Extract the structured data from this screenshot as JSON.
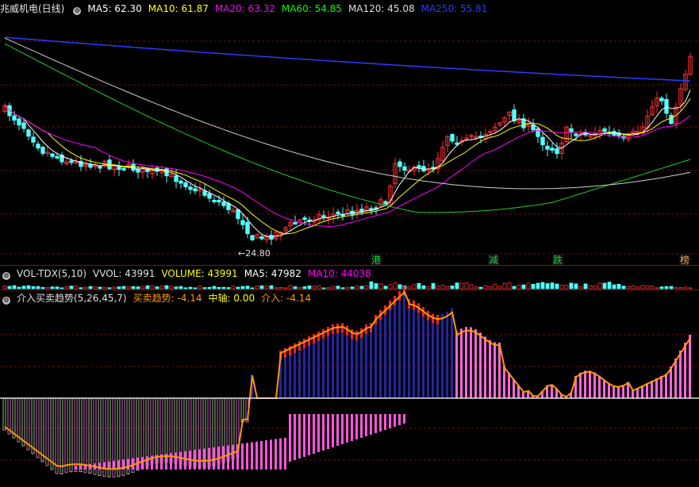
{
  "header": {
    "title": "兆威机电(日线)",
    "ma": [
      {
        "label": "MA5: 62.30",
        "color": "#ffffff"
      },
      {
        "label": "MA10: 61.87",
        "color": "#ffff00"
      },
      {
        "label": "MA20: 63.32",
        "color": "#ff00ff"
      },
      {
        "label": "MA60: 54.85",
        "color": "#00ff00"
      },
      {
        "label": "MA120: 45.08",
        "color": "#dddddd"
      },
      {
        "label": "MA250: 55.81",
        "color": "#2b3cff"
      }
    ]
  },
  "vol_header": {
    "items": [
      {
        "label": "VOL-TDX(5,10)",
        "color": "#e0e0e0"
      },
      {
        "label": "VVOL: 43991",
        "color": "#e0e0e0"
      },
      {
        "label": "VOLUME: 43991",
        "color": "#ffff00"
      },
      {
        "label": "MA5: 47982",
        "color": "#ffffff"
      },
      {
        "label": "MA10: 44038",
        "color": "#ff00ff"
      }
    ]
  },
  "ind_header": {
    "items": [
      {
        "label": "介入买卖趋势(5,26,45,7)",
        "color": "#e0e0e0"
      },
      {
        "label": "买卖趋势: -4.14",
        "color": "#ff9900"
      },
      {
        "label": "中轴: 0.00",
        "color": "#ffff00"
      },
      {
        "label": "介入: -4.14",
        "color": "#ff9900"
      }
    ]
  },
  "markers": [
    {
      "text": "港",
      "color": "#22cc44"
    },
    {
      "text": "减",
      "color": "#22cc44"
    },
    {
      "text": "跌",
      "color": "#22cc44"
    },
    {
      "text": "榜",
      "color": "#e0a050"
    }
  ],
  "low_label": "24.80",
  "chart_data": {
    "type": "candlestick",
    "series_names": [
      "MA5",
      "MA10",
      "MA20",
      "MA60",
      "MA120",
      "MA250",
      "VOLUME",
      "买卖趋势",
      "介入"
    ],
    "min_price": 24.8,
    "last": {
      "ma5": 62.3,
      "ma10": 61.87,
      "ma20": 63.32,
      "ma60": 54.85,
      "ma120": 45.08,
      "ma250": 55.81,
      "volume": 43991,
      "vol_ma5": 47982,
      "vol_ma10": 44038,
      "trend": -4.14,
      "axis": 0.0,
      "entry": -4.14
    }
  }
}
